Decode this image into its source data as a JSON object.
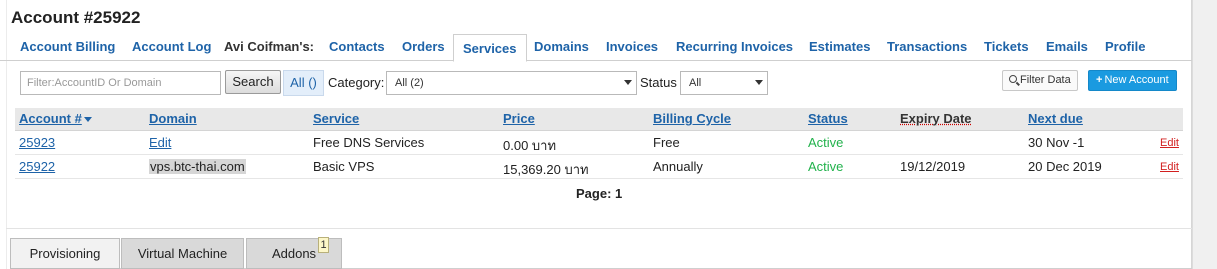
{
  "page": {
    "title": "Account #25922"
  },
  "tabs": {
    "account_billing": "Account Billing",
    "account_log": "Account Log",
    "owner_label": "Avi Coifman's:",
    "contacts": "Contacts",
    "orders": "Orders",
    "services": "Services",
    "domains": "Domains",
    "invoices": "Invoices",
    "recurring_invoices": "Recurring Invoices",
    "estimates": "Estimates",
    "transactions": "Transactions",
    "tickets": "Tickets",
    "emails": "Emails",
    "profile": "Profile",
    "active_tab": "Services"
  },
  "filters": {
    "search_placeholder": "Filter:AccountID Or Domain",
    "search_button": "Search",
    "all_button": "All ()",
    "category_label": "Category:",
    "category_value": "All (2)",
    "status_label": "Status",
    "status_value": "All",
    "filter_data_button": "Filter Data",
    "new_account_button": "New Account",
    "new_account_plus": "+"
  },
  "table": {
    "headers": {
      "account": "Account #",
      "domain": "Domain",
      "service": "Service",
      "price": "Price",
      "billing_cycle": "Billing Cycle",
      "status": "Status",
      "expiry_date": "Expiry Date",
      "next_due": "Next due"
    },
    "sort": {
      "column": "account",
      "direction": "desc"
    },
    "rows": [
      {
        "account": "25923",
        "domain": "Edit",
        "service": "Free DNS Services",
        "price": "0.00 บาท",
        "billing_cycle": "Free",
        "status": "Active",
        "expiry_date": "",
        "next_due": "30 Nov -1",
        "action": "Edit"
      },
      {
        "account": "25922",
        "domain": "vps.btc-thai.com",
        "service": "Basic VPS",
        "price": "15,369.20 บาท",
        "billing_cycle": "Annually",
        "status": "Active",
        "expiry_date": "19/12/2019",
        "next_due": "20 Dec 2019",
        "action": "Edit"
      }
    ]
  },
  "pager": {
    "label": "Page:",
    "current": "1"
  },
  "bottom_tabs": {
    "provisioning": "Provisioning",
    "virtual_machine": "Virtual Machine",
    "addons": "Addons",
    "addons_badge": "1",
    "active_tab": "Provisioning"
  },
  "colors": {
    "link": "#1e63a8",
    "status_active": "#22b24c",
    "edit_action": "#d21f1f",
    "primary_button": "#1a9ae0"
  }
}
